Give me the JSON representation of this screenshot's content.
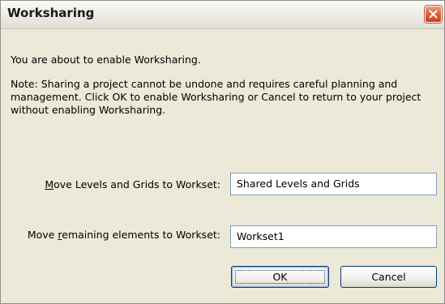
{
  "window": {
    "title": "Worksharing"
  },
  "message": {
    "intro": "You are about to enable Worksharing.",
    "note": "Note: Sharing a project cannot be undone and requires careful planning and management.  Click OK to enable Worksharing or Cancel to return to your project without enabling Worksharing."
  },
  "fields": {
    "levels": {
      "label_mnemonic": "M",
      "label_rest": "ove Levels and Grids to Workset:",
      "value": "Shared Levels and Grids"
    },
    "remaining": {
      "label_before": "Move ",
      "label_mnemonic": "r",
      "label_after": "emaining elements to Workset:",
      "value": "Workset1"
    }
  },
  "buttons": {
    "ok": "OK",
    "cancel": "Cancel"
  },
  "colors": {
    "close_button": "#e0633d",
    "dialog_background": "#ece9d8",
    "field_border": "#7f9db9"
  },
  "icons": {
    "close": "close-x-icon"
  }
}
